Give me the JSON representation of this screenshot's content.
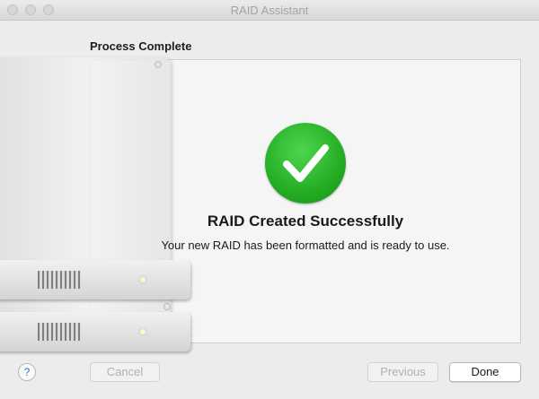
{
  "window": {
    "title": "RAID Assistant"
  },
  "heading": "Process Complete",
  "result": {
    "icon": "checkmark-circle-icon",
    "title": "RAID Created Successfully",
    "message": "Your new RAID has been formatted and is ready to use."
  },
  "buttons": {
    "help_label": "?",
    "cancel_label": "Cancel",
    "previous_label": "Previous",
    "done_label": "Done"
  },
  "colors": {
    "success_green": "#24ad24",
    "help_blue": "#2b73d7"
  }
}
